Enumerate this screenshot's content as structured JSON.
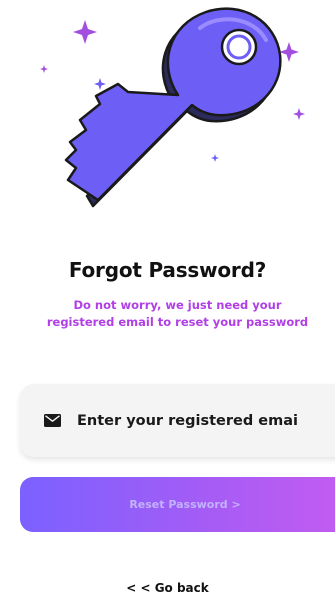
{
  "illustration": {
    "icon": "key-illustration",
    "colors": {
      "key_fill": "#6d5ff6",
      "key_shadow": "#2b2b5c",
      "outline": "#1a1a1a",
      "sparkle": "#a24fe0"
    }
  },
  "header": {
    "title": "Forgot Password?",
    "subtitle_line1": "Do not worry, we just need your",
    "subtitle_line2": "registered email to reset your password"
  },
  "form": {
    "email_placeholder": "Enter your registered email",
    "email_value": "",
    "email_icon": "mail-icon",
    "reset_label": "Reset Password >"
  },
  "footer": {
    "go_back_label": "< < Go back"
  },
  "colors": {
    "accent": "#b13fe6",
    "button_start": "#7b61ff",
    "button_end": "#c45cf0"
  }
}
